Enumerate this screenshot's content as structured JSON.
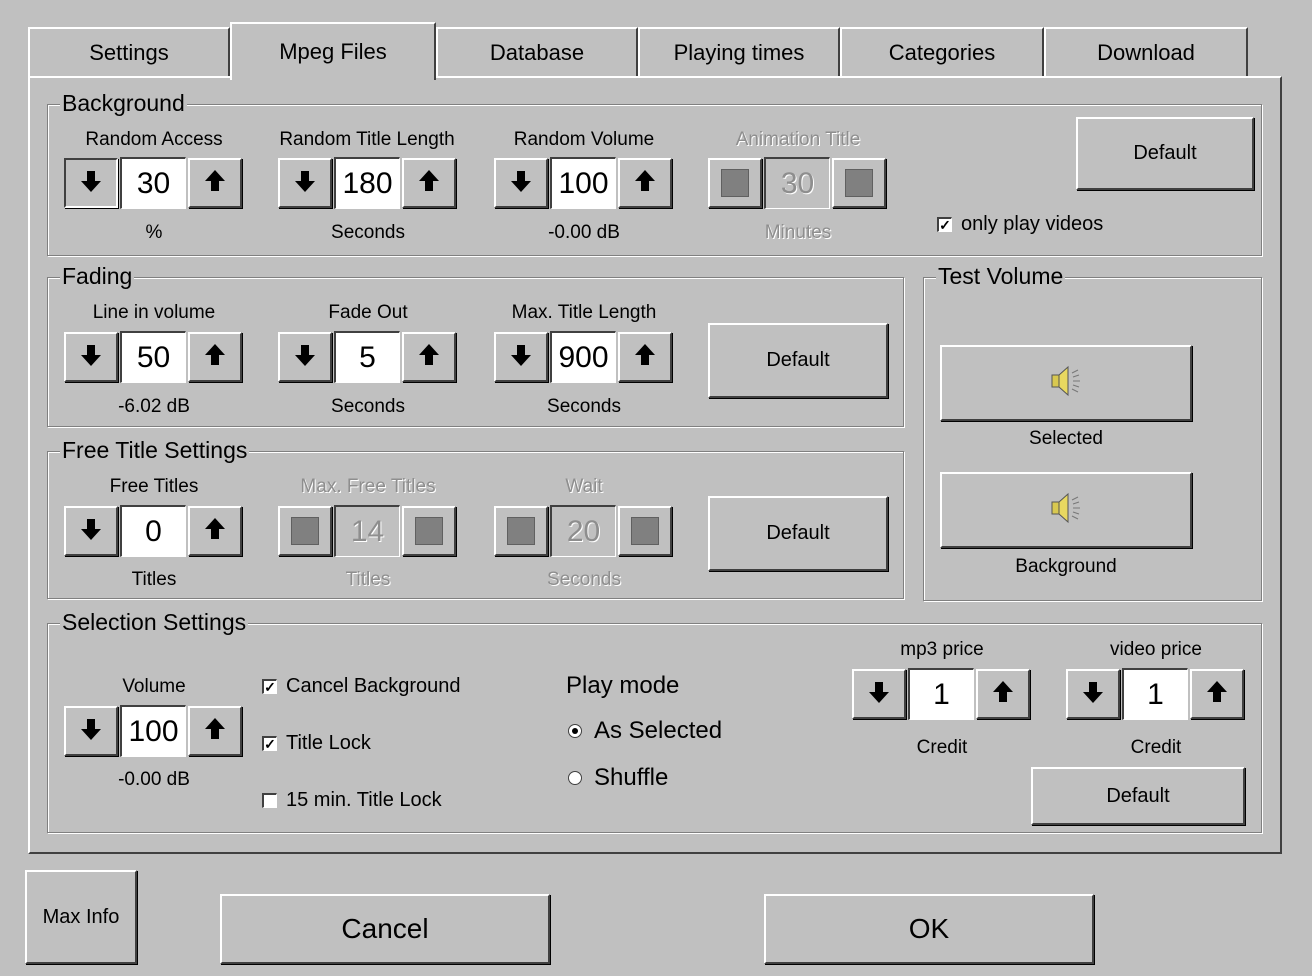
{
  "tabs": [
    {
      "label": "Settings"
    },
    {
      "label": "Mpeg Files"
    },
    {
      "label": "Database"
    },
    {
      "label": "Playing times"
    },
    {
      "label": "Categories"
    },
    {
      "label": "Download"
    }
  ],
  "active_tab": "Mpeg Files",
  "background": {
    "title": "Background",
    "random_access": {
      "label": "Random Access",
      "value": "30",
      "unit": "%"
    },
    "random_title_length": {
      "label": "Random Title Length",
      "value": "180",
      "unit": "Seconds"
    },
    "random_volume": {
      "label": "Random Volume",
      "value": "100",
      "unit": "-0.00 dB"
    },
    "animation_title": {
      "label": "Animation Title",
      "value": "30",
      "unit": "Minutes"
    },
    "default_label": "Default",
    "only_play_videos": {
      "label": "only play videos",
      "checked": true
    }
  },
  "fading": {
    "title": "Fading",
    "line_in_volume": {
      "label": "Line in volume",
      "value": "50",
      "unit": "-6.02 dB"
    },
    "fade_out": {
      "label": "Fade Out",
      "value": "5",
      "unit": "Seconds"
    },
    "max_title_length": {
      "label": "Max. Title Length",
      "value": "900",
      "unit": "Seconds"
    },
    "default_label": "Default"
  },
  "test_volume": {
    "title": "Test Volume",
    "selected_label": "Selected",
    "background_label": "Background"
  },
  "free_title": {
    "title": "Free Title Settings",
    "free_titles": {
      "label": "Free Titles",
      "value": "0",
      "unit": "Titles"
    },
    "max_free_titles": {
      "label": "Max. Free Titles",
      "value": "14",
      "unit": "Titles"
    },
    "wait": {
      "label": "Wait",
      "value": "20",
      "unit": "Seconds"
    },
    "default_label": "Default"
  },
  "selection": {
    "title": "Selection Settings",
    "volume": {
      "label": "Volume",
      "value": "100",
      "unit": "-0.00 dB"
    },
    "cancel_background": {
      "label": "Cancel Background",
      "checked": true
    },
    "title_lock": {
      "label": "Title Lock",
      "checked": true
    },
    "min15_title_lock": {
      "label": "15 min. Title Lock",
      "checked": false
    },
    "play_mode": {
      "label": "Play mode",
      "options": [
        "As Selected",
        "Shuffle"
      ],
      "selected": "As Selected"
    },
    "mp3_price": {
      "label": "mp3 price",
      "value": "1",
      "unit": "Credit"
    },
    "video_price": {
      "label": "video price",
      "value": "1",
      "unit": "Credit"
    },
    "default_label": "Default"
  },
  "footer": {
    "max_info": "Max Info",
    "cancel": "Cancel",
    "ok": "OK"
  },
  "icons": {
    "down": "arrow-down-icon",
    "up": "arrow-up-icon",
    "speaker": "speaker-icon"
  }
}
